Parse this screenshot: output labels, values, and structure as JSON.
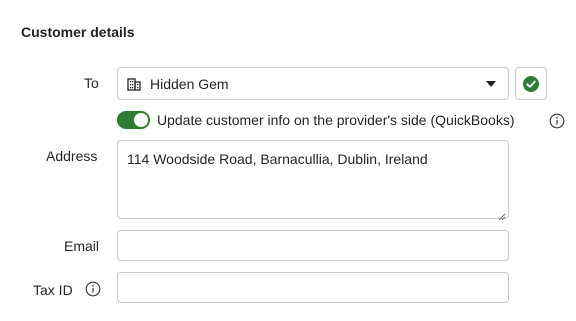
{
  "section": {
    "title": "Customer details"
  },
  "to": {
    "label": "To",
    "selected_value": "Hidden Gem",
    "icon": "building-icon",
    "confirm_icon": "check-circle-icon"
  },
  "sync": {
    "enabled": true,
    "label": "Update customer info on the provider's side (QuickBooks)",
    "info_icon": "info-icon"
  },
  "address": {
    "label": "Address",
    "value": "114 Woodside Road, Barnacullia, Dublin, Ireland"
  },
  "email": {
    "label": "Email",
    "value": ""
  },
  "tax_id": {
    "label": "Tax ID",
    "value": "",
    "info_icon": "info-icon"
  },
  "colors": {
    "toggle_on": "#2e7d32",
    "check_green": "#2e7d32",
    "border": "#c9ccd1",
    "text": "#1f2328"
  }
}
